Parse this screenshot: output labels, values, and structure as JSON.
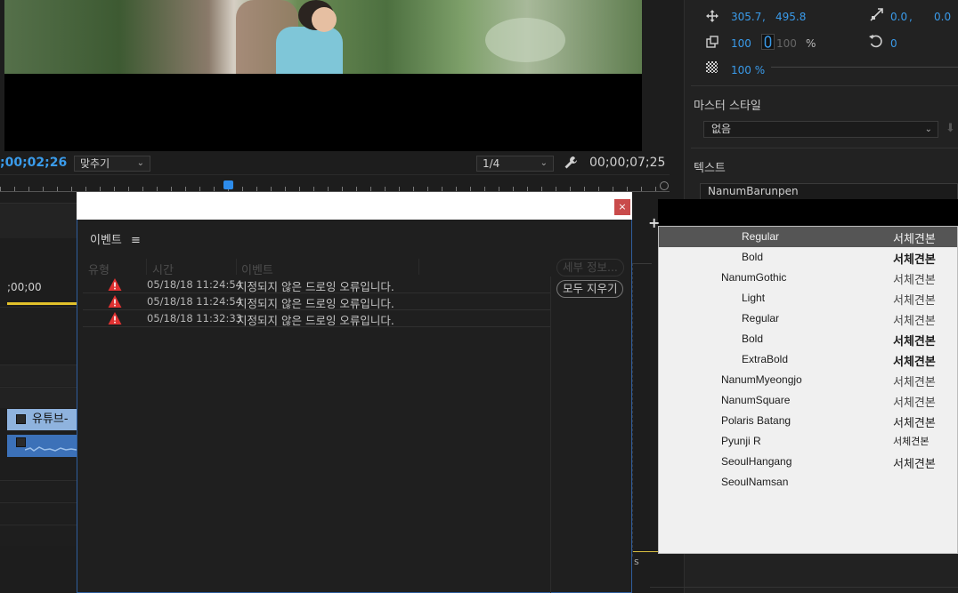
{
  "monitor": {
    "timecode_current": ";00;02;26",
    "fit_select": "맞추기",
    "resolution_select": "1/4",
    "timecode_duration": "00;00;07;25"
  },
  "timeline": {
    "timecode": ";00;00",
    "clip_label": "유튜브-"
  },
  "effect_controls": {
    "position_x": "305.7",
    "position_sep": ",",
    "position_y": "495.8",
    "anchor_x": "0.0",
    "anchor_sep": ",",
    "anchor_y": "0.0",
    "scale_w": "100",
    "scale_h": "100",
    "scale_unit": "%",
    "rotation": "0",
    "opacity": "100 %",
    "master_style_label": "마스터 스타일",
    "master_style_value": "없음",
    "text_label": "텍스트",
    "font_value": "NanumBarunpen"
  },
  "events_dialog": {
    "close_label": "×",
    "title": "이벤트",
    "menu_glyph": "≡",
    "columns": [
      "유형",
      "시간",
      "이벤트"
    ],
    "rows": [
      {
        "time": "05/18/18 11:24:54",
        "message": "지정되지 않은 드로잉 오류입니다."
      },
      {
        "time": "05/18/18 11:24:54",
        "message": "지정되지 않은 드로잉 오류입니다."
      },
      {
        "time": "05/18/18 11:32:33",
        "message": "지정되지 않은 드로잉 오류입니다."
      }
    ],
    "details_button": "세부 정보...",
    "clear_all_button": "모두 지우기"
  },
  "font_menu": {
    "items": [
      {
        "name": "Regular",
        "sample": "서체견본",
        "level": 2,
        "weight": "normal",
        "highlighted": true
      },
      {
        "name": "Bold",
        "sample": "서체견본",
        "level": 2,
        "weight": "bold"
      },
      {
        "name": "NanumGothic",
        "sample": "서체견본",
        "level": 1,
        "weight": "light"
      },
      {
        "name": "Light",
        "sample": "서체견본",
        "level": 2,
        "weight": "light"
      },
      {
        "name": "Regular",
        "sample": "서체견본",
        "level": 2,
        "weight": "light"
      },
      {
        "name": "Bold",
        "sample": "서체견본",
        "level": 2,
        "weight": "bold"
      },
      {
        "name": "ExtraBold",
        "sample": "서체견본",
        "level": 2,
        "weight": "bold"
      },
      {
        "name": "NanumMyeongjo",
        "sample": "서체견본",
        "level": 1,
        "weight": "light"
      },
      {
        "name": "NanumSquare",
        "sample": "서체견본",
        "level": 1,
        "weight": "light"
      },
      {
        "name": "Polaris Batang",
        "sample": "서체견본",
        "level": 1,
        "weight": "normal"
      },
      {
        "name": "Pyunji R",
        "sample": "서체견본",
        "level": 1,
        "weight": "small"
      },
      {
        "name": "SeoulHangang",
        "sample": "서체견본",
        "level": 1,
        "weight": "normal"
      },
      {
        "name": "SeoulNamsan",
        "sample": "",
        "level": 1,
        "weight": "normal"
      }
    ]
  },
  "colors": {
    "accent_blue": "#3a9bea",
    "warning_red": "#e03131",
    "menu_highlight": "#555555",
    "close_button": "#c94b4b"
  }
}
